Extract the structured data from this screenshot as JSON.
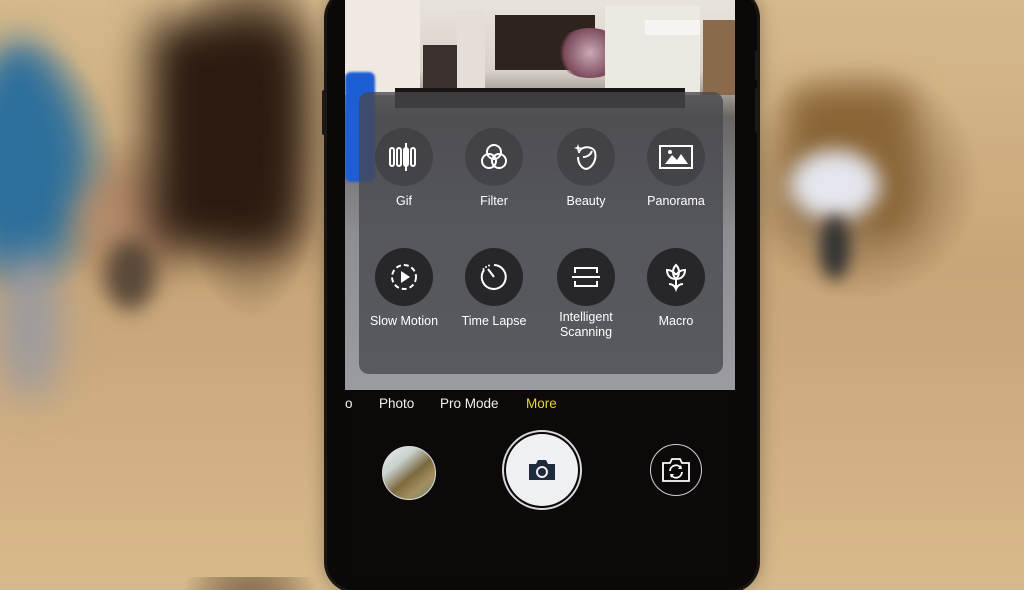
{
  "app": "Camera",
  "more_panel": {
    "modes": [
      {
        "id": "gif",
        "label": "Gif",
        "icon": "gif-icon"
      },
      {
        "id": "filter",
        "label": "Filter",
        "icon": "filter-icon"
      },
      {
        "id": "beauty",
        "label": "Beauty",
        "icon": "beauty-icon"
      },
      {
        "id": "panorama",
        "label": "Panorama",
        "icon": "panorama-icon"
      },
      {
        "id": "slow-motion",
        "label": "Slow Motion",
        "icon": "slow-motion-icon"
      },
      {
        "id": "time-lapse",
        "label": "Time Lapse",
        "icon": "time-lapse-icon"
      },
      {
        "id": "intelligent-scanning",
        "label": "Intelligent Scanning",
        "label_line1": "Intelligent",
        "label_line2": "Scanning",
        "icon": "scan-icon"
      },
      {
        "id": "macro",
        "label": "Macro",
        "icon": "macro-icon"
      }
    ]
  },
  "mode_tabs": {
    "items": [
      {
        "label": "o",
        "active": false
      },
      {
        "label": "Photo",
        "active": false
      },
      {
        "label": "Pro Mode",
        "active": false
      },
      {
        "label": "More",
        "active": true
      }
    ],
    "active_color": "#e8d234",
    "inactive_color": "#f1f1f1"
  },
  "controls": {
    "gallery_thumbnail": "gallery-thumbnail",
    "shutter": "camera-icon",
    "switch_camera": "switch-camera-icon"
  }
}
